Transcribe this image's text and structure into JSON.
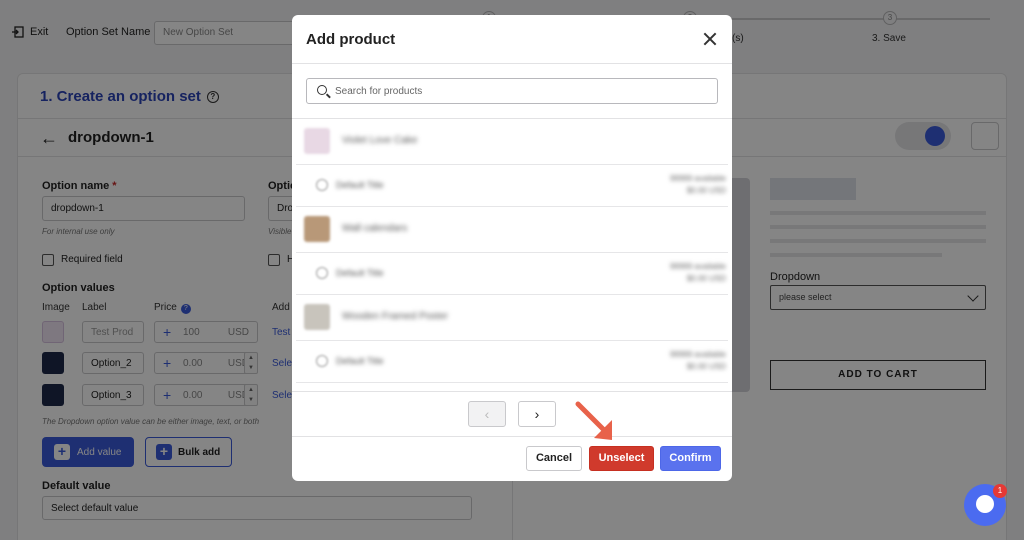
{
  "topbar": {
    "exit_label": "Exit",
    "option_set_name_label": "Option Set Name",
    "option_set_name_placeholder": "New Option Set",
    "steps": [
      {
        "label": "",
        "num": "1"
      },
      {
        "label": "(s)",
        "num": "2"
      },
      {
        "label": "3. Save",
        "num": "3"
      }
    ]
  },
  "card": {
    "title": "1. Create an option set",
    "option_title": "dropdown-1",
    "option_name_label": "Option name",
    "required_mark": "*",
    "option_name_value": "dropdown-1",
    "option_name_hint": "For internal use only",
    "other_label": "Optio",
    "other_value": "Dro",
    "other_hint": "Visible",
    "required_field_label": "Required field",
    "other_checkbox_label": "H",
    "option_values_label": "Option values",
    "col_image": "Image",
    "col_label": "Label",
    "col_price": "Price",
    "col_add": "Add",
    "rows": [
      {
        "label": "Test Prod",
        "price": "100",
        "currency": "USD",
        "link": "Test"
      },
      {
        "label": "Option_2",
        "price": "0.00",
        "currency": "USD",
        "link": "Selec"
      },
      {
        "label": "Option_3",
        "price": "0.00",
        "currency": "USD",
        "link": "Selec"
      }
    ],
    "values_hint": "The Dropdown option value can be either image, text, or both",
    "add_value_label": "Add value",
    "bulk_add_label": "Bulk add",
    "default_value_label": "Default value",
    "default_value_select": "Select default value"
  },
  "preview": {
    "dropdown_label": "Dropdown",
    "dropdown_placeholder": "please select",
    "add_to_cart": "ADD TO CART"
  },
  "modal": {
    "title": "Add product",
    "search_placeholder": "Search for products",
    "items": [
      {
        "kind": "product",
        "title": "Violet Love Cake",
        "thumb_color": "#e8d8e4"
      },
      {
        "kind": "variant",
        "title": "Default Title",
        "meta1": "99999 available",
        "meta2": "$0.00 USD"
      },
      {
        "kind": "product",
        "title": "Wall calendars",
        "thumb_color": "#b89878"
      },
      {
        "kind": "variant",
        "title": "Default Title",
        "meta1": "99999 available",
        "meta2": "$0.00 USD"
      },
      {
        "kind": "product",
        "title": "Wooden Framed Poster",
        "thumb_color": "#c8c4bc"
      },
      {
        "kind": "variant",
        "title": "Default Title",
        "meta1": "99999 available",
        "meta2": "$0.00 USD"
      }
    ],
    "prev_label": "‹",
    "next_label": "›",
    "cancel_label": "Cancel",
    "unselect_label": "Unselect",
    "confirm_label": "Confirm"
  },
  "chat": {
    "badge_count": "1"
  },
  "colors": {
    "accent": "#3b5bdb",
    "danger": "#d03a2c",
    "confirm": "#5a72ee",
    "arrow": "#e8624a"
  }
}
